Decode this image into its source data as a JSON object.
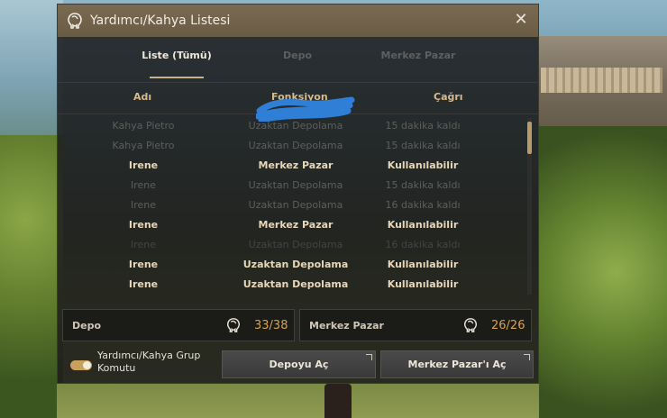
{
  "window": {
    "title": "Yardımcı/Kahya Listesi",
    "close_symbol": "✕"
  },
  "tabs": [
    {
      "label": "Liste (Tümü)",
      "active": true
    },
    {
      "label": "Depo",
      "active": false
    },
    {
      "label": "Merkez Pazar",
      "active": false
    }
  ],
  "columns": {
    "name": "Adı",
    "function": "Fonksiyon",
    "call": "Çağrı"
  },
  "rows": [
    {
      "name": "Kahya Pietro",
      "function": "Uzaktan Depolama",
      "call": "15 dakika kaldı",
      "state": "muted"
    },
    {
      "name": "Kahya Pietro",
      "function": "Uzaktan Depolama",
      "call": "15 dakika kaldı",
      "state": "muted"
    },
    {
      "name": "Irene",
      "function": "Merkez Pazar",
      "call": "Kullanılabilir",
      "state": "active"
    },
    {
      "name": "Irene",
      "function": "Uzaktan Depolama",
      "call": "15 dakika kaldı",
      "state": "muted"
    },
    {
      "name": "Irene",
      "function": "Uzaktan Depolama",
      "call": "16 dakika kaldı",
      "state": "muted"
    },
    {
      "name": "Irene",
      "function": "Merkez Pazar",
      "call": "Kullanılabilir",
      "state": "active"
    },
    {
      "name": "Irene",
      "function": "Uzaktan Depolama",
      "call": "16 dakika kaldı",
      "state": "dim"
    },
    {
      "name": "Irene",
      "function": "Uzaktan Depolama",
      "call": "Kullanılabilir",
      "state": "active"
    },
    {
      "name": "Irene",
      "function": "Uzaktan Depolama",
      "call": "Kullanılabilir",
      "state": "active"
    }
  ],
  "stats": {
    "storage": {
      "label": "Depo",
      "value": "33/38"
    },
    "market": {
      "label": "Merkez Pazar",
      "value": "26/26"
    }
  },
  "footer": {
    "toggle_label": "Yardımcı/Kahya Grup Komutu",
    "toggle_on": true,
    "open_storage_button": "Depoyu Aç",
    "open_market_button": "Merkez Pazar'ı Aç"
  },
  "colors": {
    "accent": "#d7a14e",
    "header_text": "#d8b98a",
    "titlebar": "#6f604a"
  },
  "icons": {
    "title": "butler-head-icon",
    "stat": "butler-head-icon",
    "close": "close-icon"
  }
}
